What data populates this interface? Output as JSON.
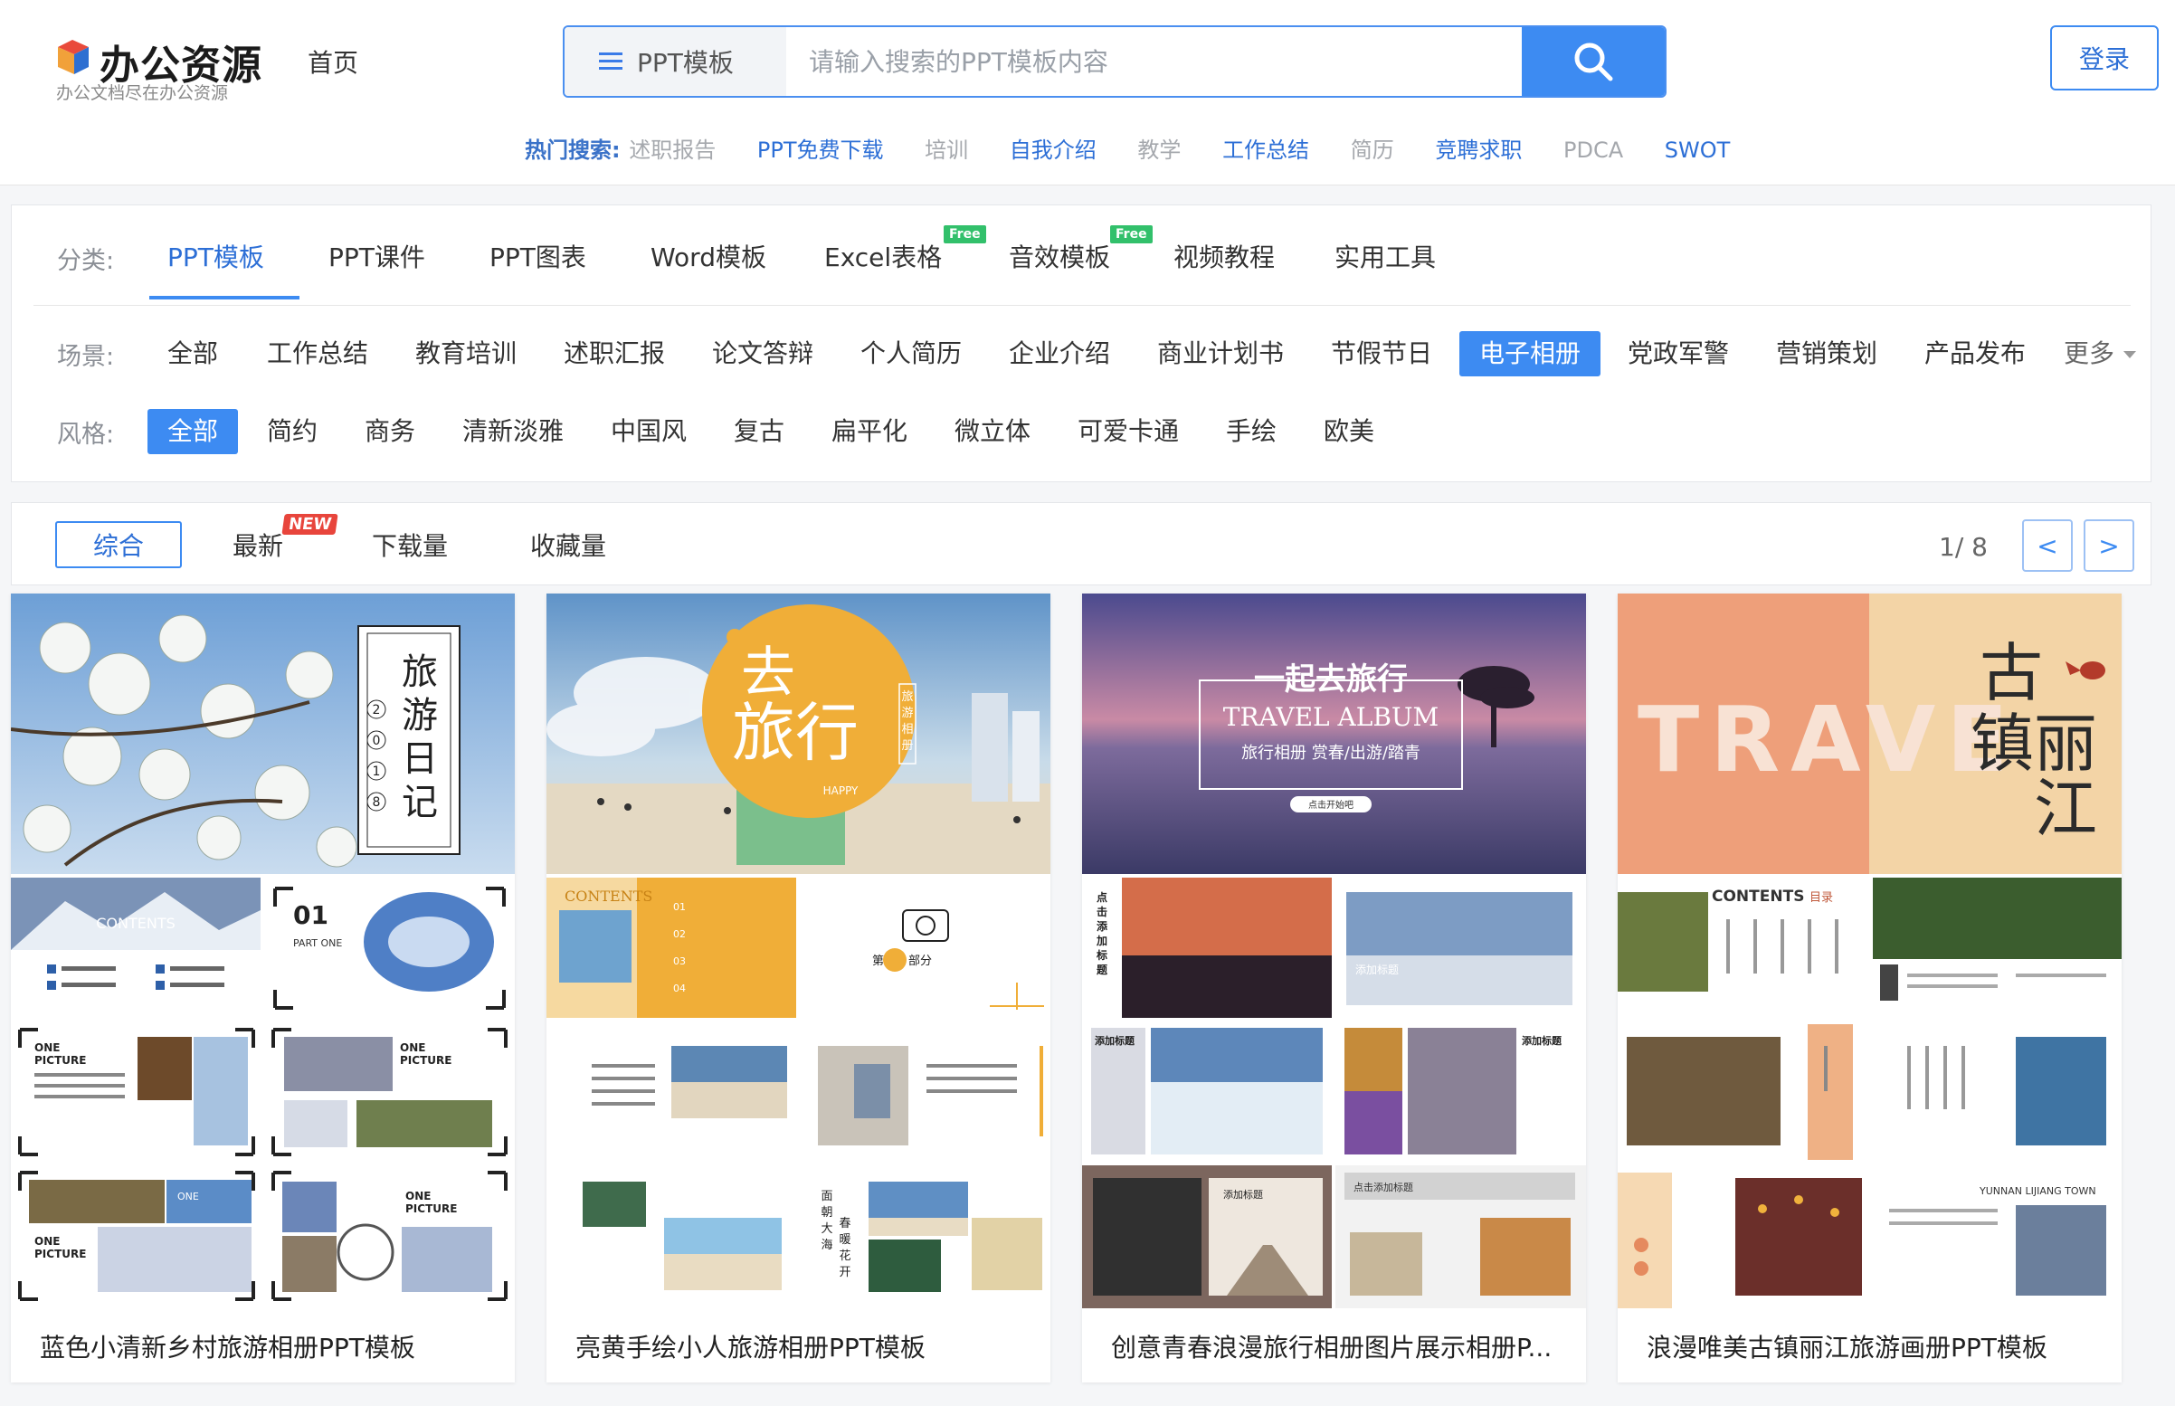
{
  "logo": {
    "title": "办公资源",
    "subtitle": "办公文档尽在办公资源"
  },
  "nav": {
    "home": "首页"
  },
  "search": {
    "type_label": "PPT模板",
    "placeholder": "请输入搜索的PPT模板内容"
  },
  "hot": {
    "label": "热门搜索:",
    "items": [
      {
        "text": "述职报告",
        "style": "gray"
      },
      {
        "text": "PPT免费下载",
        "style": "blue"
      },
      {
        "text": "培训",
        "style": "gray"
      },
      {
        "text": "自我介绍",
        "style": "blue"
      },
      {
        "text": "教学",
        "style": "gray"
      },
      {
        "text": "工作总结",
        "style": "blue"
      },
      {
        "text": "简历",
        "style": "gray"
      },
      {
        "text": "竞聘求职",
        "style": "blue"
      },
      {
        "text": "PDCA",
        "style": "gray"
      },
      {
        "text": "SWOT",
        "style": "blue"
      }
    ]
  },
  "login": "登录",
  "filters": {
    "category": {
      "label": "分类:",
      "items": [
        "PPT模板",
        "PPT课件",
        "PPT图表",
        "Word模板",
        "Excel表格",
        "音效模板",
        "视频教程",
        "实用工具"
      ],
      "active": "PPT模板",
      "free_badge": "Free"
    },
    "scene": {
      "label": "场景:",
      "items": [
        "全部",
        "工作总结",
        "教育培训",
        "述职汇报",
        "论文答辩",
        "个人简历",
        "企业介绍",
        "商业计划书",
        "节假节日",
        "电子相册",
        "党政军警",
        "营销策划",
        "产品发布"
      ],
      "active": "电子相册",
      "more": "更多"
    },
    "style": {
      "label": "风格:",
      "items": [
        "全部",
        "简约",
        "商务",
        "清新淡雅",
        "中国风",
        "复古",
        "扁平化",
        "微立体",
        "可爱卡通",
        "手绘",
        "欧美"
      ],
      "active": "全部"
    }
  },
  "sort": {
    "items": [
      "综合",
      "最新",
      "下载量",
      "收藏量"
    ],
    "active": "综合",
    "new_badge": "NEW",
    "page": "1/ 8",
    "prev": "<",
    "next": ">"
  },
  "cards": [
    {
      "title": "蓝色小清新乡村旅游相册PPT模板",
      "cover_text": "旅游日记",
      "year": "2018",
      "slide_text": [
        "CONTENTS",
        "01",
        "PART ONE",
        "ONE PICTURE"
      ]
    },
    {
      "title": "亮黄手绘小人旅游相册PPT模板",
      "cover_text": "去旅行",
      "sub": "HAPPY",
      "vert": "旅游相册",
      "slide_text": [
        "CONTENTS",
        "第一部分",
        "面朝大海 春暖花开"
      ]
    },
    {
      "title": "创意青春浪漫旅行相册图片展示相册P...",
      "cover_text": "一起去旅行",
      "sub": "TRAVEL ALBUM",
      "tagline": "旅行相册 赏春/出游/踏青",
      "btn": "点击开始吧",
      "slide_text": [
        "点击添加标题",
        "添加标题"
      ]
    },
    {
      "title": "浪漫唯美古镇丽江旅游画册PPT模板",
      "cover_text": "古镇丽江",
      "sub": "TRAVE",
      "slide_text": [
        "CONTENTS 目录",
        "YUNNAN LIJIANG TOWN"
      ]
    }
  ],
  "colors": {
    "accent": "#3d8bf2",
    "free": "#32c06b",
    "new": "#e8453c",
    "yellow": "#f0b84a",
    "peach": "#ee9f7a"
  }
}
